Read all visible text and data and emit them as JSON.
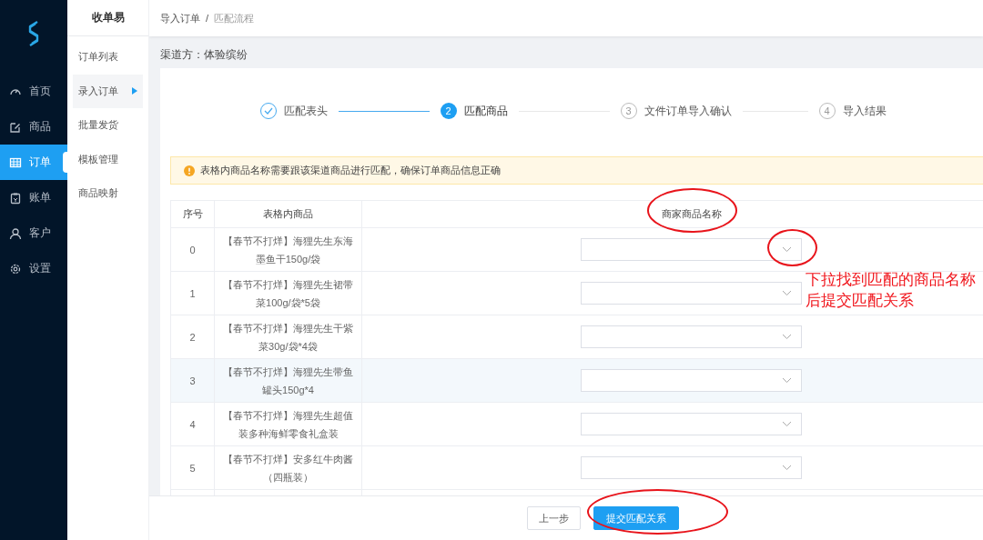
{
  "nav": {
    "items": [
      {
        "label": "首页",
        "selected": false
      },
      {
        "label": "商品",
        "selected": false
      },
      {
        "label": "订单",
        "selected": true
      },
      {
        "label": "账单",
        "selected": false
      },
      {
        "label": "客户",
        "selected": false
      },
      {
        "label": "设置",
        "selected": false
      }
    ]
  },
  "submenu": {
    "title": "收单易",
    "items": [
      {
        "label": "订单列表",
        "selected": false
      },
      {
        "label": "录入订单",
        "selected": true
      },
      {
        "label": "批量发货",
        "selected": false
      },
      {
        "label": "模板管理",
        "selected": false
      },
      {
        "label": "商品映射",
        "selected": false
      }
    ]
  },
  "breadcrumb": [
    "导入订单",
    "/",
    "匹配流程"
  ],
  "channel": "渠道方：体验缤纷",
  "steps": [
    {
      "label": "匹配表头",
      "kind": "done"
    },
    {
      "number": "2",
      "label": "匹配商品",
      "kind": "active"
    },
    {
      "number": "3",
      "label": "文件订单导入确认",
      "kind": "waiting"
    },
    {
      "number": "4",
      "label": "导入结果",
      "kind": "waiting"
    }
  ],
  "alert": "表格内商品名称需要跟该渠道商品进行匹配，确保订单商品信息正确",
  "table": {
    "columns": [
      "序号",
      "表格内商品",
      "商家商品名称"
    ],
    "rows": [
      {
        "index": "0",
        "product": "【春节不打烊】海狸先生东海墨鱼干150g/袋",
        "hovered": false
      },
      {
        "index": "1",
        "product": "【春节不打烊】海狸先生裙带菜100g/袋*5袋",
        "hovered": false
      },
      {
        "index": "2",
        "product": "【春节不打烊】海狸先生干紫菜30g/袋*4袋",
        "hovered": false
      },
      {
        "index": "3",
        "product": "【春节不打烊】海狸先生带鱼罐头150g*4",
        "hovered": true
      },
      {
        "index": "4",
        "product": "【春节不打烊】海狸先生超值装多种海鲜零食礼盒装",
        "hovered": false
      },
      {
        "index": "5",
        "product": "【春节不打烊】安多红牛肉酱（四瓶装）",
        "hovered": false
      }
    ]
  },
  "buttons": [
    {
      "label": "上一步",
      "kind": "secondary"
    },
    {
      "label": "提交匹配关系",
      "kind": "primary"
    }
  ],
  "annotation": {
    "note": "下拉找到匹配的商品名称后提交匹配关系"
  }
}
